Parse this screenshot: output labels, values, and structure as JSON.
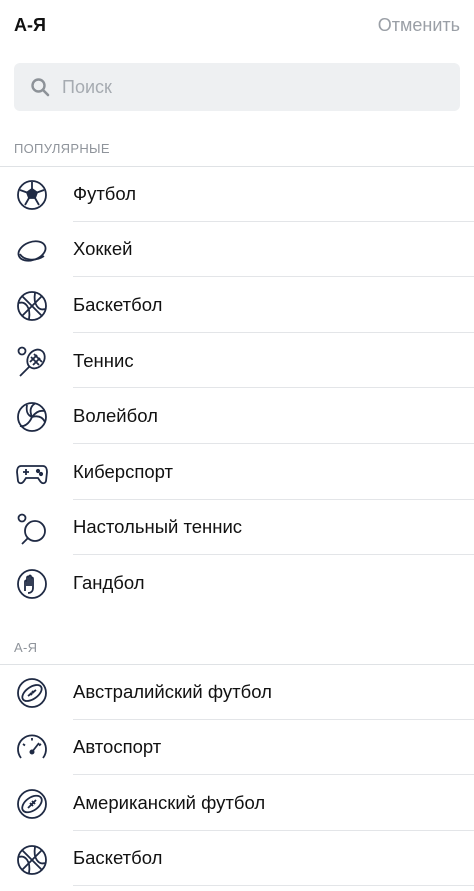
{
  "header": {
    "title": "А-Я",
    "cancel_label": "Отменить"
  },
  "search": {
    "placeholder": "Поиск",
    "value": ""
  },
  "popular": {
    "title": "ПОПУЛЯРНЫЕ",
    "items": [
      {
        "label": "Футбол",
        "icon": "soccer-ball-icon"
      },
      {
        "label": "Хоккей",
        "icon": "hockey-puck-icon"
      },
      {
        "label": "Баскетбол",
        "icon": "basketball-icon"
      },
      {
        "label": "Теннис",
        "icon": "tennis-racket-icon"
      },
      {
        "label": "Волейбол",
        "icon": "volleyball-icon"
      },
      {
        "label": "Киберспорт",
        "icon": "gamepad-icon"
      },
      {
        "label": "Настольный теннис",
        "icon": "ping-pong-paddle-icon"
      },
      {
        "label": "Гандбол",
        "icon": "handball-icon"
      }
    ]
  },
  "az": {
    "title": "А-Я",
    "items": [
      {
        "label": "Австралийский футбол",
        "icon": "aussie-football-icon"
      },
      {
        "label": "Автоспорт",
        "icon": "speedometer-icon"
      },
      {
        "label": "Американский футбол",
        "icon": "american-football-icon"
      },
      {
        "label": "Баскетбол",
        "icon": "basketball-icon"
      }
    ]
  }
}
